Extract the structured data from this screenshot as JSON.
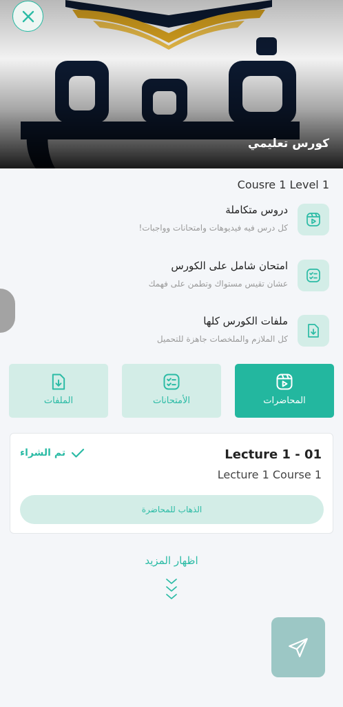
{
  "hero": {
    "title": "كورس تعليمي"
  },
  "course": {
    "subtitle": "Cousre 1 Level 1"
  },
  "features": [
    {
      "title": "دروس متكاملة",
      "desc": "كل درس فيه فيديوهات وامتحانات وواجبات!",
      "icon": "video-lesson-icon"
    },
    {
      "title": "امتحان شامل على الكورس",
      "desc": "عشان تقيس مستواك وتطمن على فهمك",
      "icon": "checklist-icon"
    },
    {
      "title": "ملفات الكورس كلها",
      "desc": "كل الملازم والملخصات جاهزة للتحميل",
      "icon": "file-download-icon"
    }
  ],
  "tabs": [
    {
      "label": "المحاضرات",
      "active": true,
      "icon": "video-lesson-icon"
    },
    {
      "label": "الأمتحانات",
      "active": false,
      "icon": "checklist-icon"
    },
    {
      "label": "الملفات",
      "active": false,
      "icon": "file-download-icon"
    }
  ],
  "lecture": {
    "title": "Lecture 1 - 01",
    "subtitle": "Lecture 1 Course 1",
    "status": "تم الشراء",
    "action": "الذهاب للمحاضرة"
  },
  "show_more": "اظهار المزيد",
  "colors": {
    "accent": "#23b79f",
    "accent_light": "#d3ede7",
    "send_button": "#9cc7c5",
    "logo_navy": "#0d1b33",
    "logo_gold": "#e0a820"
  }
}
